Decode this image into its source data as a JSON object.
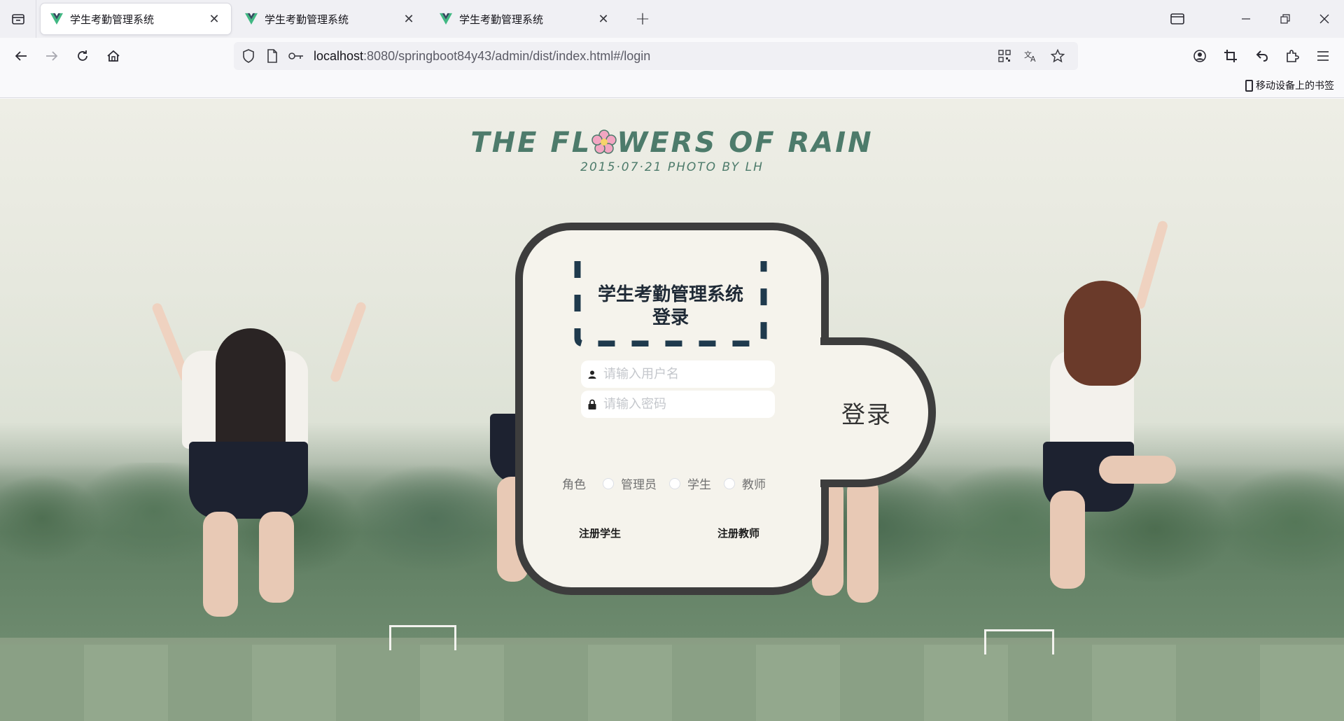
{
  "browser": {
    "tabs": [
      {
        "title": "学生考勤管理系统",
        "active": true
      },
      {
        "title": "学生考勤管理系统",
        "active": false
      },
      {
        "title": "学生考勤管理系统",
        "active": false
      }
    ],
    "url_host": "localhost",
    "url_rest": ":8080/springboot84y43/admin/dist/index.html#/login",
    "bookmark_mobile": "移动设备上的书签"
  },
  "page": {
    "title_main_a": "THE FL",
    "title_main_b": "WERS OF RAIN",
    "title_sub": "2015·07·21 PHOTO BY LH"
  },
  "login": {
    "title": "学生考勤管理系统",
    "subtitle": "登录",
    "username_placeholder": "请输入用户名",
    "password_placeholder": "请输入密码",
    "role_label": "角色",
    "roles": [
      "管理员",
      "学生",
      "教师"
    ],
    "register_student": "注册学生",
    "register_teacher": "注册教师",
    "login_button": "登录"
  },
  "colors": {
    "accent_title": "#4d7b6b",
    "card_border": "#3d3d3d",
    "card_bg": "#f5f3ec",
    "dash_color": "#1f3a4d"
  }
}
